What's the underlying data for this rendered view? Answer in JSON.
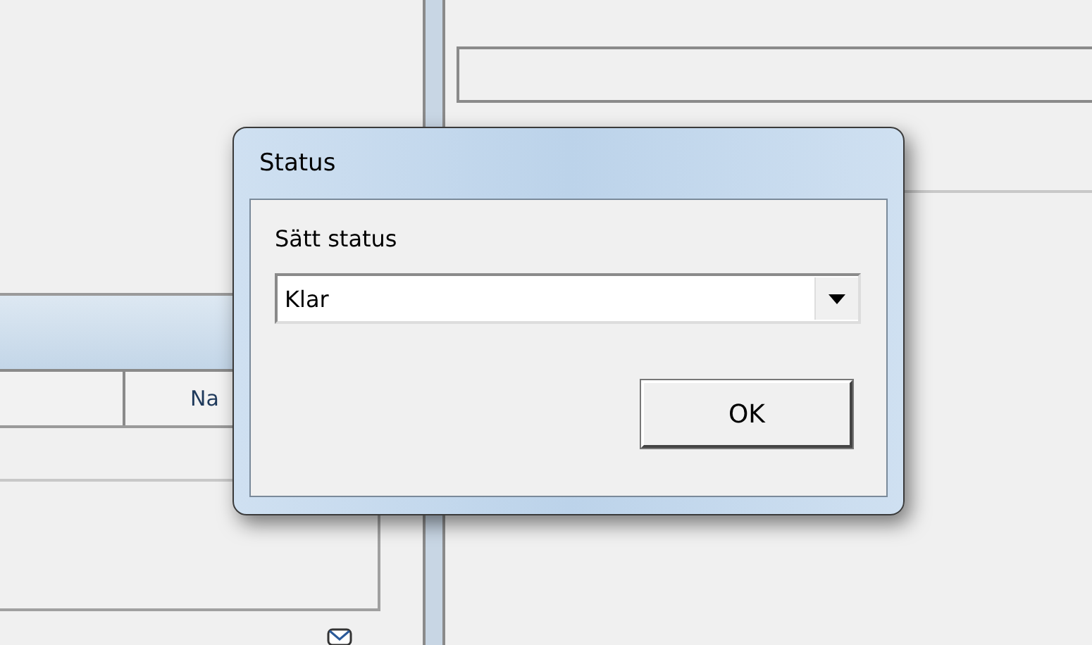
{
  "background_window": {
    "list_header": {
      "column_2": "Na"
    }
  },
  "dialog": {
    "title": "Status",
    "label": "Sätt status",
    "select": {
      "value": "Klar"
    },
    "buttons": [
      "OK"
    ]
  }
}
